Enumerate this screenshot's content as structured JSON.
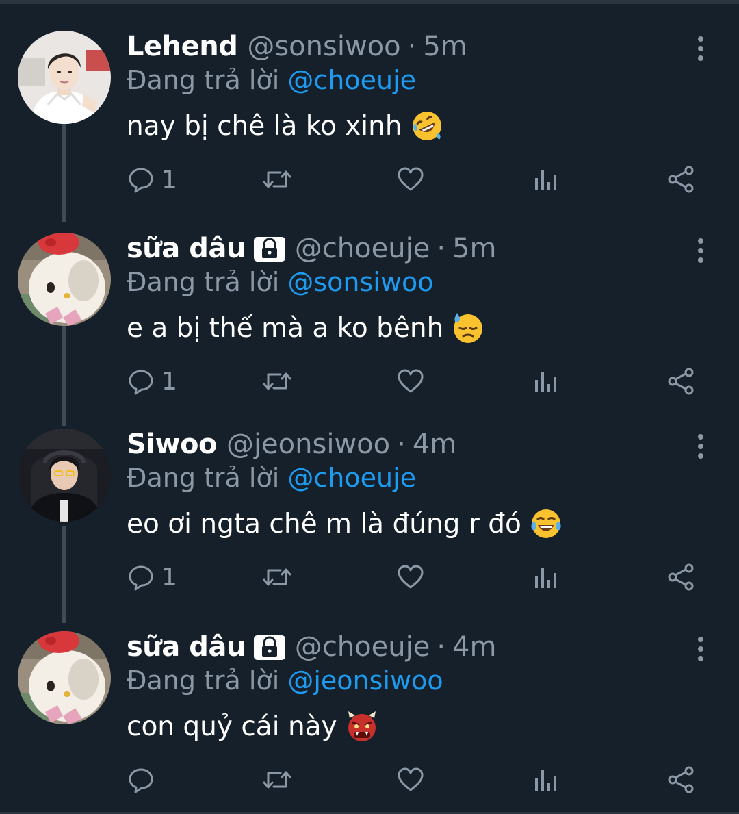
{
  "colors": {
    "background": "#15202b",
    "text": "#ffffff",
    "muted": "#8b98a5",
    "mention": "#1d9bf0",
    "thread_line": "#3d4a57"
  },
  "reply_prefix": "Đang trả lời",
  "tweets": [
    {
      "display_name": "Lehend",
      "protected": false,
      "handle": "@sonsiwoo",
      "separator": "·",
      "time": "5m",
      "reply_to": "@choeuje",
      "text": "nay bị chê là ko xinh",
      "emoji_icon": "rolling-on-floor-laughing-emoji",
      "reply_count": "1",
      "avatar_icon": "profile-photo-lehend"
    },
    {
      "display_name": "sữa dâu",
      "protected": true,
      "handle": "@choeuje",
      "separator": "·",
      "time": "5m",
      "reply_to": "@sonsiwoo",
      "text": "e a bị thế mà a ko bênh",
      "emoji_icon": "downcast-face-with-sweat-emoji",
      "reply_count": "1",
      "avatar_icon": "profile-photo-hello-kitty"
    },
    {
      "display_name": "Siwoo",
      "protected": false,
      "handle": "@jeonsiwoo",
      "separator": "·",
      "time": "4m",
      "reply_to": "@choeuje",
      "text": "eo ơi ngta chê m là đúng r đó",
      "emoji_icon": "face-with-tears-of-joy-emoji",
      "reply_count": "1",
      "avatar_icon": "profile-photo-siwoo"
    },
    {
      "display_name": "sữa dâu",
      "protected": true,
      "handle": "@choeuje",
      "separator": "·",
      "time": "4m",
      "reply_to": "@jeonsiwoo",
      "text": "con quỷ cái này",
      "emoji_icon": "ogre-emoji",
      "reply_count": "",
      "avatar_icon": "profile-photo-hello-kitty"
    }
  ],
  "action_icons": [
    "reply-icon",
    "retweet-icon",
    "like-icon",
    "analytics-icon",
    "share-icon"
  ]
}
